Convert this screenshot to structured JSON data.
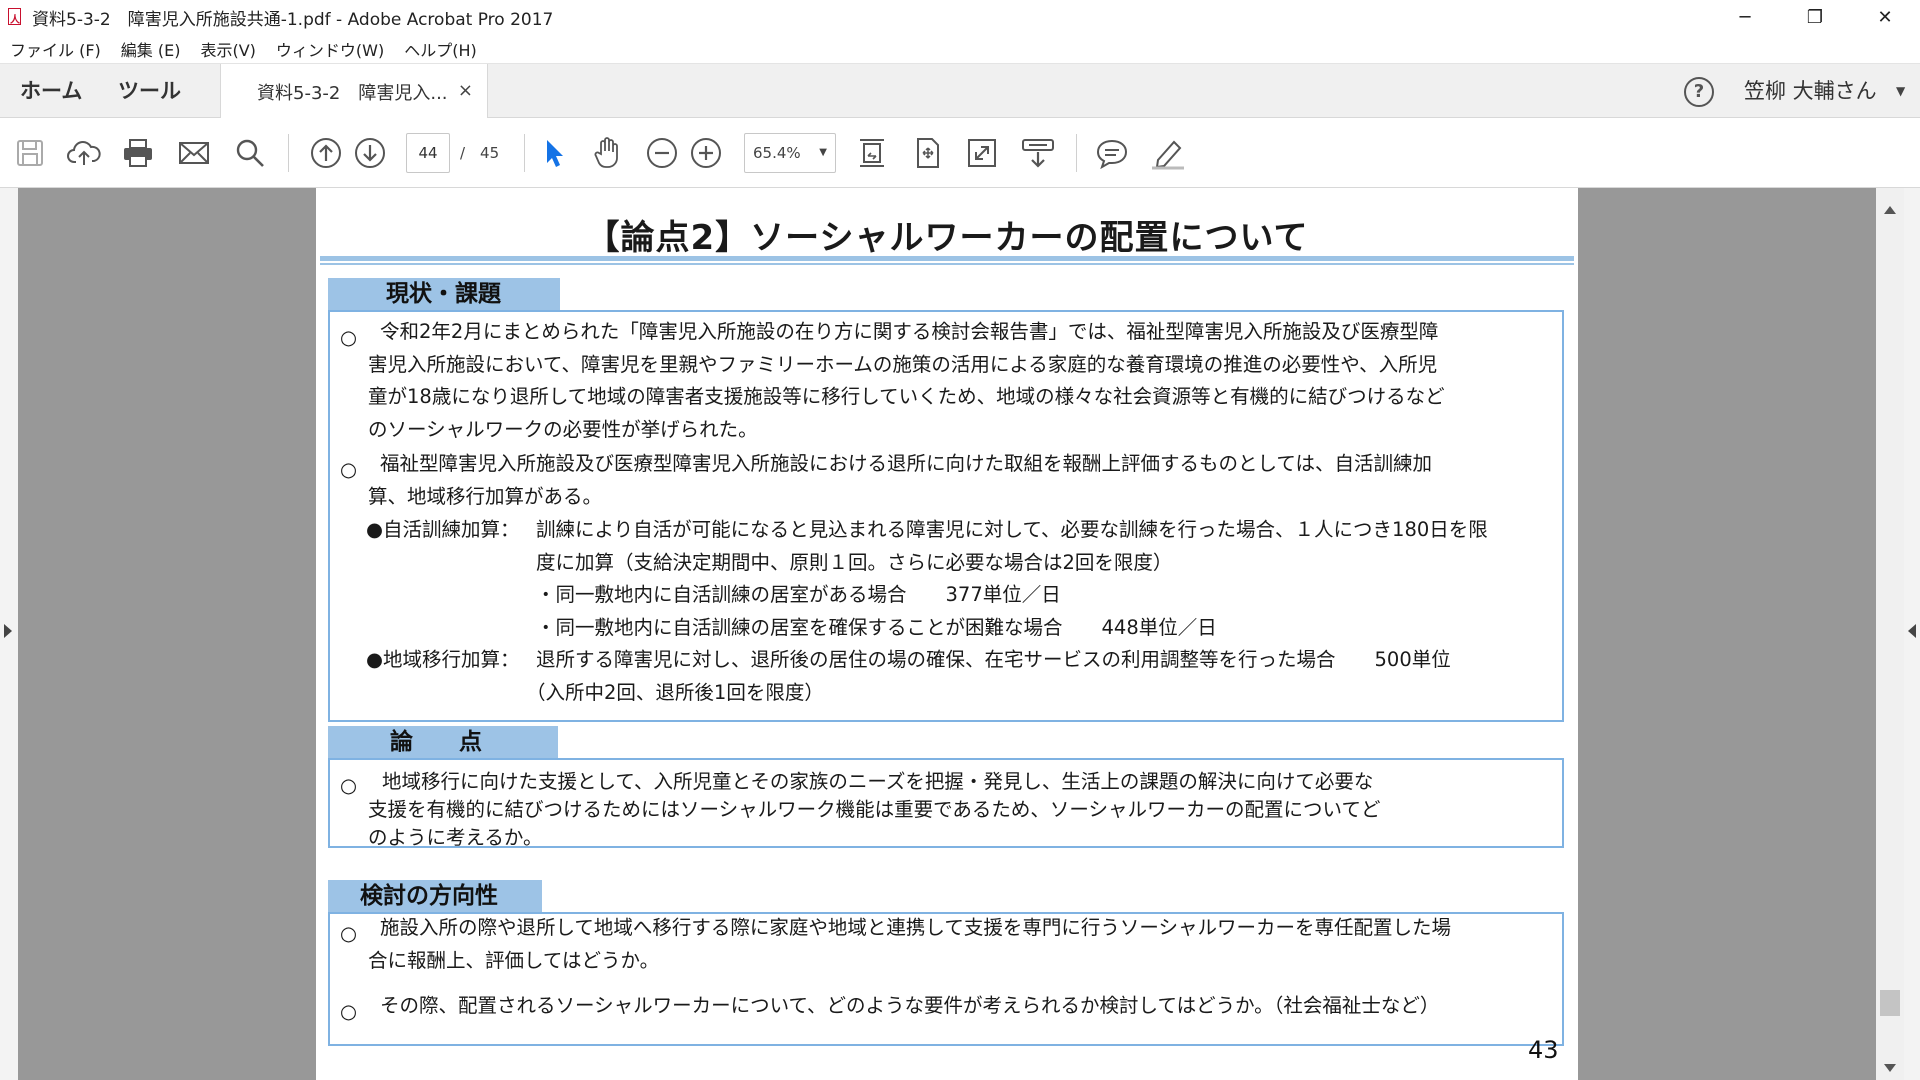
{
  "window": {
    "title": "資料5-3-2　障害児入所施設共通-1.pdf - Adobe Acrobat Pro 2017",
    "minimize": "─",
    "maximize": "❐",
    "close": "✕"
  },
  "menu": [
    "ファイル (F)",
    "編集 (E)",
    "表示(V)",
    "ウィンドウ(W)",
    "ヘルプ(H)"
  ],
  "tabs": {
    "home": "ホーム",
    "tools": "ツール",
    "document": "資料5-3-2　障害児入...",
    "close": "×"
  },
  "account": {
    "help": "?",
    "user": "笠柳 大輔さん",
    "caret": "▼"
  },
  "toolbar": {
    "current_page": "44",
    "page_total": "/　45",
    "zoom": "65.4%",
    "zoom_caret": "▼"
  },
  "slide": {
    "title": "【論点2】ソーシャルワーカーの配置について",
    "section1": {
      "label": "現状・課題",
      "p1_bullet": "○",
      "p1_lines": [
        "令和2年2月にまとめられた「障害児入所施設の在り方に関する検討会報告書」では、福祉型障害児入所施設及び医療型障",
        "害児入所施設において、障害児を里親やファミリーホームの施策の活用による家庭的な養育環境の推進の必要性や、入所児",
        "童が18歳になり退所して地域の障害者支援施設等に移行していくため、地域の様々な社会資源等と有機的に結びつけるなど",
        "のソーシャルワークの必要性が挙げられた。"
      ],
      "p2_bullet": "○",
      "p2_lines": [
        "福祉型障害児入所施設及び医療型障害児入所施設における退所に向けた取組を報酬上評価するものとしては、自活訓練加",
        "算、地域移行加算がある。"
      ],
      "item1_label": "●自活訓練加算：",
      "item1_lines": [
        "訓練により自活が可能になると見込まれる障害児に対して、必要な訓練を行った場合、１人につき180日を限",
        "度に加算（支給決定期間中、原則１回。さらに必要な場合は2回を限度）",
        "・同一敷地内に自活訓練の居室がある場合　　377単位／日",
        "・同一敷地内に自活訓練の居室を確保することが困難な場合　　448単位／日"
      ],
      "item2_label": "●地域移行加算：",
      "item2_lines": [
        "退所する障害児に対し、退所後の居住の場の確保、在宅サービスの利用調整等を行った場合　　500単位",
        "（入所中2回、退所後1回を限度）"
      ]
    },
    "section2": {
      "label": "論　　点",
      "bullet": "○",
      "lines": [
        "地域移行に向けた支援として、入所児童とその家族のニーズを把握・発見し、生活上の課題の解決に向けて必要な",
        "支援を有機的に結びつけるためにはソーシャルワーク機能は重要であるため、ソーシャルワーカーの配置についてど",
        "のように考えるか。"
      ]
    },
    "section3": {
      "label": "検討の方向性",
      "p1_bullet": "○",
      "p1_lines": [
        "施設入所の際や退所して地域へ移行する際に家庭や地域と連携して支援を専門に行うソーシャルワーカーを専任配置した場",
        "合に報酬上、評価してはどうか。"
      ],
      "p2_bullet": "○",
      "p2_line": "その際、配置されるソーシャルワーカーについて、どのような要件が考えられるか検討してはどうか。（社会福祉士など）"
    },
    "page_number": "43"
  },
  "colors": {
    "section_label_bg": "#9dc3e6",
    "section_border": "#7fb2e2",
    "title_rule": "#9cc3e5",
    "doc_background": "#989898",
    "select_tool": "#1473e6"
  }
}
